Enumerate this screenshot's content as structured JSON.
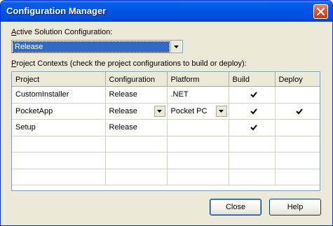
{
  "window": {
    "title": "Configuration Manager"
  },
  "active_config": {
    "label_accel": "A",
    "label_rest": "ctive Solution Configuration:",
    "value": "Release"
  },
  "contexts": {
    "label_accel": "P",
    "label_rest": "roject Contexts (check the project configurations to build or deploy):"
  },
  "table": {
    "columns": [
      "Project",
      "Configuration",
      "Platform",
      "Build",
      "Deploy"
    ],
    "rows": [
      {
        "project": "CustomInstaller",
        "configuration": "Release",
        "platform": ".NET",
        "build": true,
        "deploy": false
      },
      {
        "project": "PocketApp",
        "configuration": "Release",
        "platform": "Pocket PC",
        "build": true,
        "deploy": true
      },
      {
        "project": "Setup",
        "configuration": "Release",
        "platform": "",
        "build": true,
        "deploy": false
      }
    ]
  },
  "buttons": {
    "close": "Close",
    "help": "Help"
  },
  "icons": {
    "close": "close-icon",
    "dropdown": "chevron-down-icon",
    "check": "checkmark-icon"
  }
}
